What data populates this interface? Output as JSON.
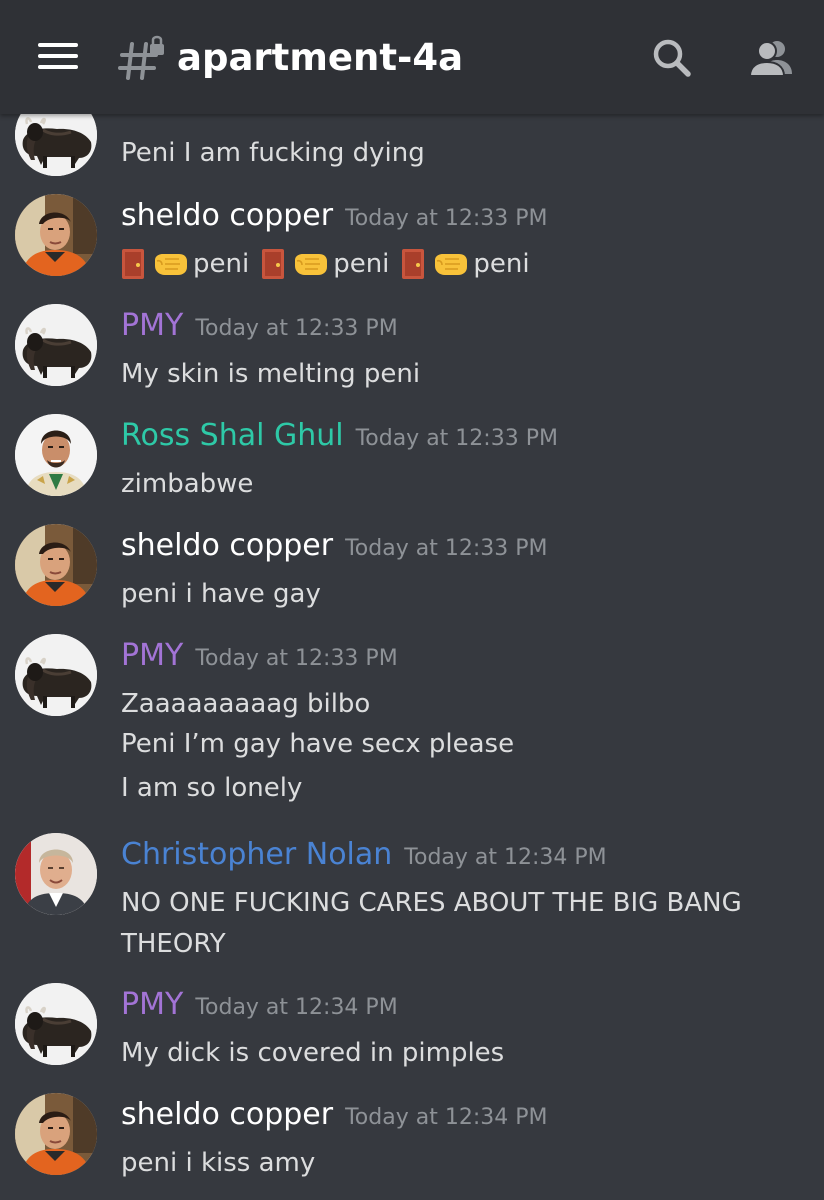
{
  "channel": {
    "name": "apartment-4a",
    "icon": "hash-lock-icon"
  },
  "header_icons": [
    "menu-icon",
    "search-icon",
    "members-icon"
  ],
  "colors": {
    "background": "#36393f",
    "header": "#2f3136",
    "pmy": "#a374d6",
    "sheldo": "#ffffff",
    "ross": "#2ec9a7",
    "nolan": "#4a83d3",
    "timestamp": "#8e9297",
    "text": "#dcddde"
  },
  "partial_message": {
    "text": "Peni I am fucking dying"
  },
  "messages": [
    {
      "author": "sheldo copper",
      "time": "Today at 12:33 PM",
      "emoji_line": [
        "peni",
        "peni",
        "peni"
      ]
    },
    {
      "author": "PMY",
      "time": "Today at 12:33 PM",
      "lines": [
        "My skin is melting peni"
      ]
    },
    {
      "author": "Ross Shal Ghul",
      "time": "Today at 12:33 PM",
      "lines": [
        "zimbabwe"
      ]
    },
    {
      "author": "sheldo copper",
      "time": "Today at 12:33 PM",
      "lines": [
        "peni i have gay"
      ]
    },
    {
      "author": "PMY",
      "time": "Today at 12:33 PM",
      "lines": [
        "Zaaaaaaaaag bilbo",
        "Peni I’m gay have secx please",
        "I am so lonely"
      ]
    },
    {
      "author": "Christopher Nolan",
      "time": "Today at 12:34 PM",
      "lines": [
        "NO ONE FUCKING CARES ABOUT THE BIG BANG",
        "THEORY"
      ]
    },
    {
      "author": "PMY",
      "time": "Today at 12:34 PM",
      "lines": [
        "My dick is covered in pimples"
      ]
    },
    {
      "author": "sheldo copper",
      "time": "Today at 12:34 PM",
      "lines": [
        "peni i kiss amy"
      ]
    }
  ]
}
